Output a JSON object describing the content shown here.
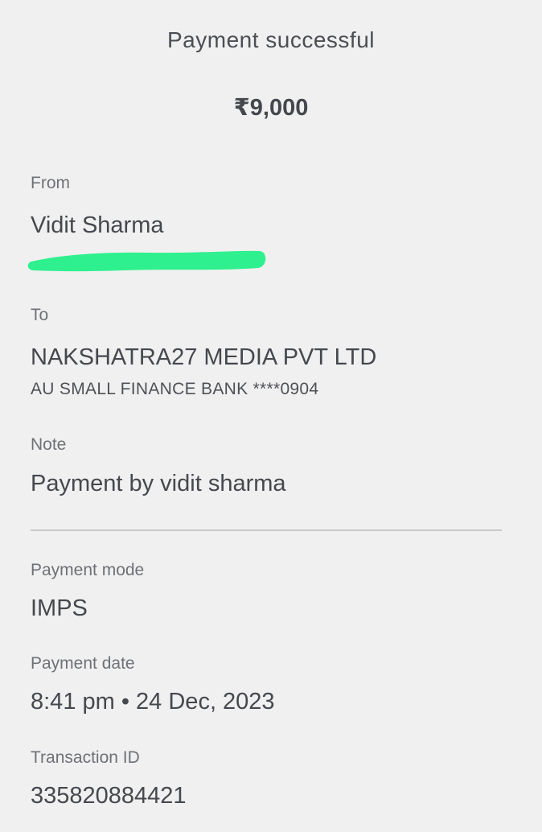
{
  "header": {
    "title": "Payment successful",
    "amount": "₹9,000"
  },
  "from": {
    "label": "From",
    "name": "Vidit Sharma"
  },
  "to": {
    "label": "To",
    "name": "NAKSHATRA27 MEDIA PVT LTD",
    "bank": "AU SMALL FINANCE BANK ****0904"
  },
  "note": {
    "label": "Note",
    "value": "Payment by vidit sharma"
  },
  "payment_mode": {
    "label": "Payment mode",
    "value": "IMPS"
  },
  "payment_date": {
    "label": "Payment date",
    "value": "8:41 pm • 24 Dec, 2023"
  },
  "transaction": {
    "label": "Transaction ID",
    "value": "335820884421"
  },
  "colors": {
    "background": "#f0f0f0",
    "text": "#474a4f",
    "label": "#6e7176",
    "redaction": "#2ff08e"
  }
}
